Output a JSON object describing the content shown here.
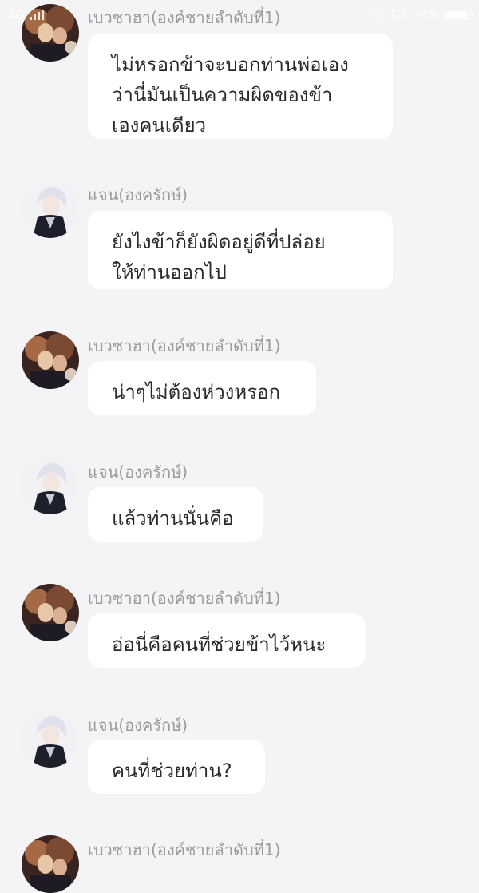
{
  "status_bar": {
    "carrier": "4G",
    "network": "4G",
    "battery_text": "94%",
    "battery_level": 0.94
  },
  "colors": {
    "background": "#f4f4f6",
    "bubble": "#ffffff",
    "sender_name": "#9b9b9b",
    "text": "#2a2a2a"
  },
  "messages": [
    {
      "sender": "เบวซาฮา(องค์ชายลำดับที่1)",
      "avatar": "prince-avatar",
      "text": "ไม่หรอกข้าจะบอกท่านพ่อเอง\nว่านี่มันเป็นความผิดของข้า\nเองคนเดียว"
    },
    {
      "sender": "แจน(องครักษ์)",
      "avatar": "guard-avatar",
      "text": "ยังไงข้าก็ยังผิดอยู่ดีที่ปล่อย\nให้ท่านออกไป"
    },
    {
      "sender": "เบวซาฮา(องค์ชายลำดับที่1)",
      "avatar": "prince-avatar",
      "text": "น่าๆไม่ต้องห่วงหรอก"
    },
    {
      "sender": "แจน(องครักษ์)",
      "avatar": "guard-avatar",
      "text": "แล้วท่านนั่นคือ"
    },
    {
      "sender": "เบวซาฮา(องค์ชายลำดับที่1)",
      "avatar": "prince-avatar",
      "text": "อ่อนี่คือคนที่ช่วยข้าไว้หนะ"
    },
    {
      "sender": "แจน(องครักษ์)",
      "avatar": "guard-avatar",
      "text": "คนที่ช่วยท่าน?"
    },
    {
      "sender": "เบวซาฮา(องค์ชายลำดับที่1)",
      "avatar": "prince-avatar",
      "text": ""
    }
  ]
}
